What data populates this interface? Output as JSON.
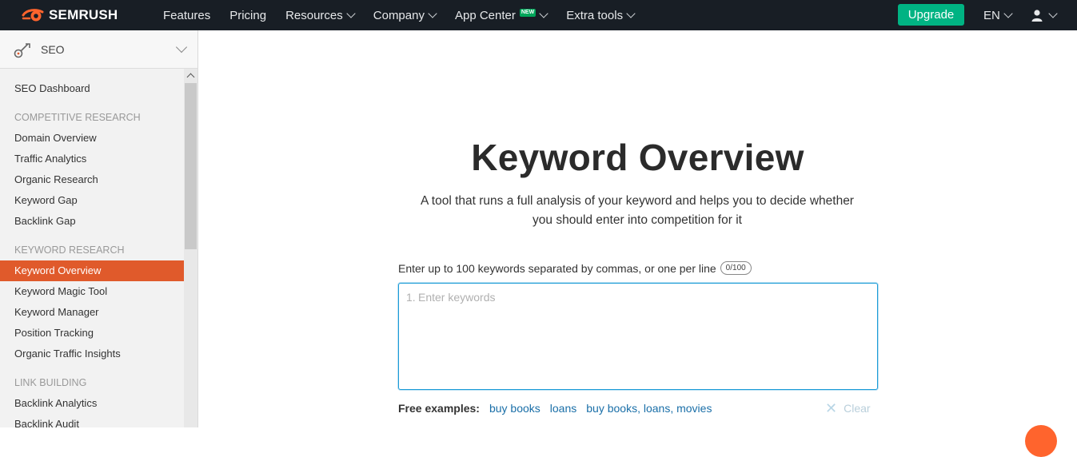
{
  "topbar": {
    "brand": "SEMRUSH",
    "nav": [
      {
        "label": "Features",
        "dropdown": false
      },
      {
        "label": "Pricing",
        "dropdown": false
      },
      {
        "label": "Resources",
        "dropdown": true
      },
      {
        "label": "Company",
        "dropdown": true
      },
      {
        "label": "App Center",
        "dropdown": true,
        "badge": "NEW"
      },
      {
        "label": "Extra tools",
        "dropdown": true
      }
    ],
    "upgrade": "Upgrade",
    "language": "EN"
  },
  "sidebar": {
    "header": "SEO",
    "items": [
      {
        "type": "item",
        "label": "SEO Dashboard"
      },
      {
        "type": "section",
        "label": "COMPETITIVE RESEARCH"
      },
      {
        "type": "item",
        "label": "Domain Overview"
      },
      {
        "type": "item",
        "label": "Traffic Analytics"
      },
      {
        "type": "item",
        "label": "Organic Research"
      },
      {
        "type": "item",
        "label": "Keyword Gap"
      },
      {
        "type": "item",
        "label": "Backlink Gap"
      },
      {
        "type": "section",
        "label": "KEYWORD RESEARCH"
      },
      {
        "type": "item",
        "label": "Keyword Overview",
        "active": true
      },
      {
        "type": "item",
        "label": "Keyword Magic Tool"
      },
      {
        "type": "item",
        "label": "Keyword Manager"
      },
      {
        "type": "item",
        "label": "Position Tracking"
      },
      {
        "type": "item",
        "label": "Organic Traffic Insights"
      },
      {
        "type": "section",
        "label": "LINK BUILDING"
      },
      {
        "type": "item",
        "label": "Backlink Analytics"
      },
      {
        "type": "item",
        "label": "Backlink Audit"
      }
    ]
  },
  "main": {
    "title": "Keyword Overview",
    "subtitle": "A tool that runs a full analysis of your keyword and helps you to decide whether you should enter into competition for it",
    "input_label": "Enter up to 100 keywords separated by commas, or one per line",
    "counter": "0/100",
    "line_number": "1.",
    "placeholder": "Enter keywords",
    "examples_label": "Free examples:",
    "examples": [
      "buy books",
      "loans",
      "buy books, loans, movies"
    ],
    "clear": "Clear"
  },
  "colors": {
    "topbar_bg": "#181e25",
    "brand_orange": "#ff642d",
    "active_item": "#e05a2b",
    "upgrade_green": "#00b383",
    "link_blue": "#1a6fa8",
    "input_border": "#1a9bd7"
  }
}
